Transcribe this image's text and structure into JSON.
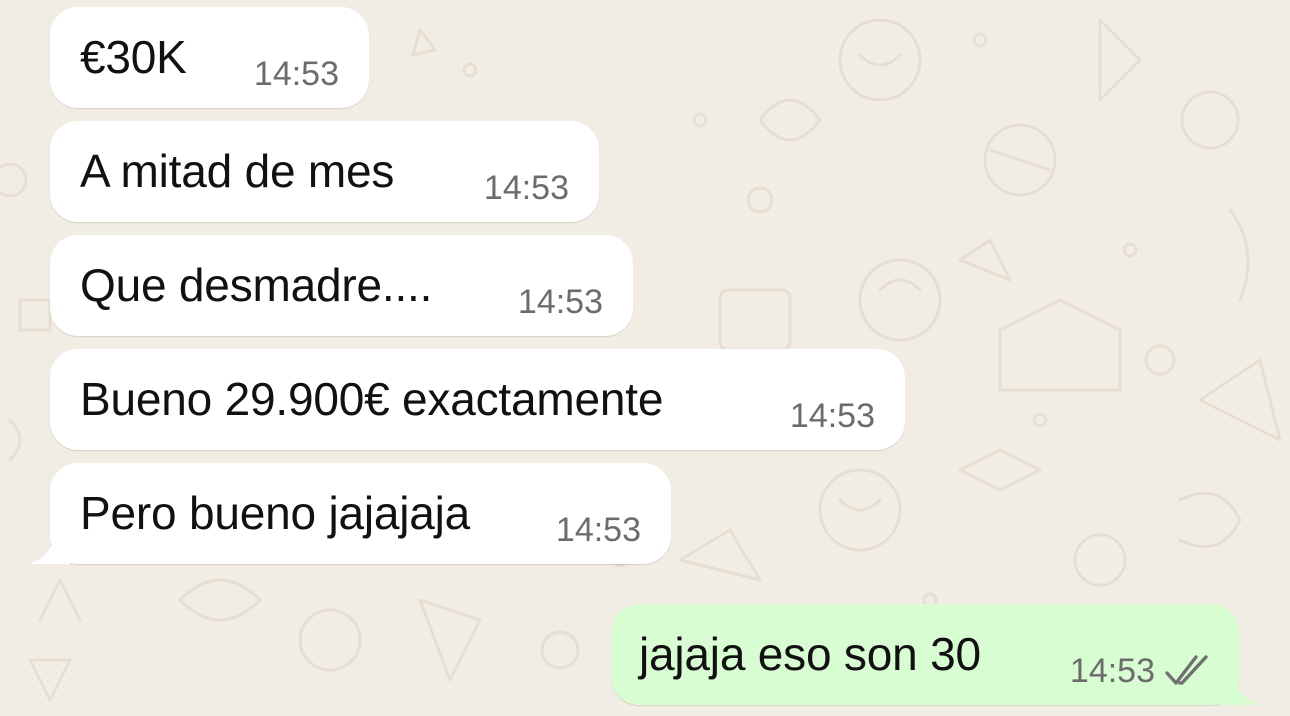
{
  "chat": {
    "messages": [
      {
        "text": "€30K",
        "time": "14:53",
        "direction": "incoming"
      },
      {
        "text": "A mitad de mes",
        "time": "14:53",
        "direction": "incoming"
      },
      {
        "text": "Que desmadre....",
        "time": "14:53",
        "direction": "incoming"
      },
      {
        "text": "Bueno 29.900€ exactamente",
        "time": "14:53",
        "direction": "incoming"
      },
      {
        "text": "Pero bueno jajajaja",
        "time": "14:53",
        "direction": "incoming"
      },
      {
        "text": "jajaja eso son 30",
        "time": "14:53",
        "direction": "outgoing",
        "status_icon": "double-check-read-icon"
      }
    ]
  },
  "colors": {
    "background": "#f2ede4",
    "incoming_bubble": "#ffffff",
    "outgoing_bubble": "#d9fdd3",
    "timestamp": "#6c6c6c",
    "read_check": "#707070"
  }
}
